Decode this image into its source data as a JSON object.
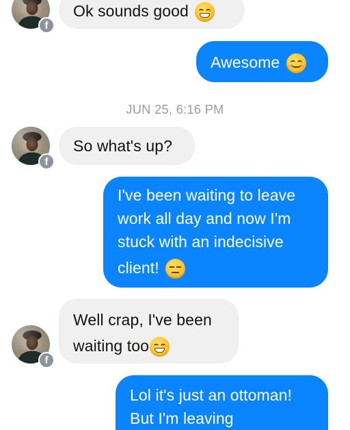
{
  "thread": {
    "messages": [
      {
        "sender": "them",
        "text": "Ok sounds good",
        "emoji": "grinning-face-with-smiling-eyes"
      },
      {
        "sender": "me",
        "text": "Awesome",
        "emoji": "smiling-face-with-smiling-eyes"
      },
      {
        "sender": "them",
        "text": "So what's up?"
      },
      {
        "sender": "me",
        "lines": [
          "I've been waiting to leave",
          "work all day and now I'm",
          "stuck with an indecisive",
          "client!"
        ],
        "emoji": "expressionless-face"
      },
      {
        "sender": "them",
        "lines": [
          "Well crap, I've been",
          "waiting too"
        ],
        "emoji": "grinning-face-with-smiling-eyes"
      },
      {
        "sender": "me",
        "lines": [
          "Lol it's just an ottoman!",
          "But I'm leaving"
        ]
      }
    ],
    "timestamp": "JUN 25, 6:16 PM",
    "badge_glyph": "f"
  },
  "colors": {
    "outgoing_bubble": "#0a84ff",
    "incoming_bubble": "#f1f0f0",
    "timestamp_text": "#9a9a9f"
  }
}
